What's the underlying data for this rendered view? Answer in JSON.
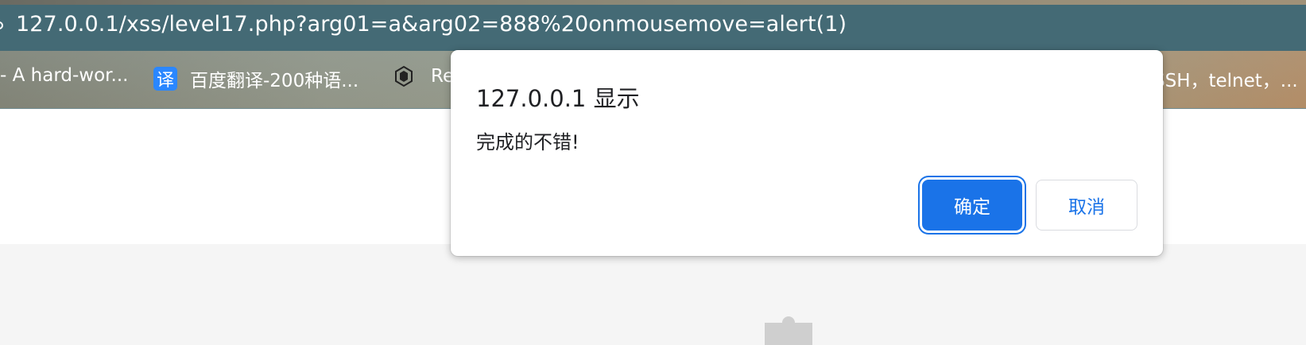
{
  "browser": {
    "url": "127.0.0.1/xss/level17.php?arg01=a&arg02=888%20onmousemove=alert(1)",
    "bookmarks": [
      {
        "label": "- A hard-wor...",
        "icon": "none"
      },
      {
        "label": "百度翻译-200种语...",
        "icon": "baidu-translate-icon",
        "icon_text": "译"
      },
      {
        "label": "Re",
        "icon": "hive-icon"
      },
      {
        "label": "有SSH，telnet，..."
      }
    ]
  },
  "dialog": {
    "title": "127.0.0.1 显示",
    "message": "完成的不错!",
    "ok_label": "确定",
    "cancel_label": "取消"
  },
  "colors": {
    "address_bar": "#446a75",
    "accent": "#1a73e8"
  }
}
